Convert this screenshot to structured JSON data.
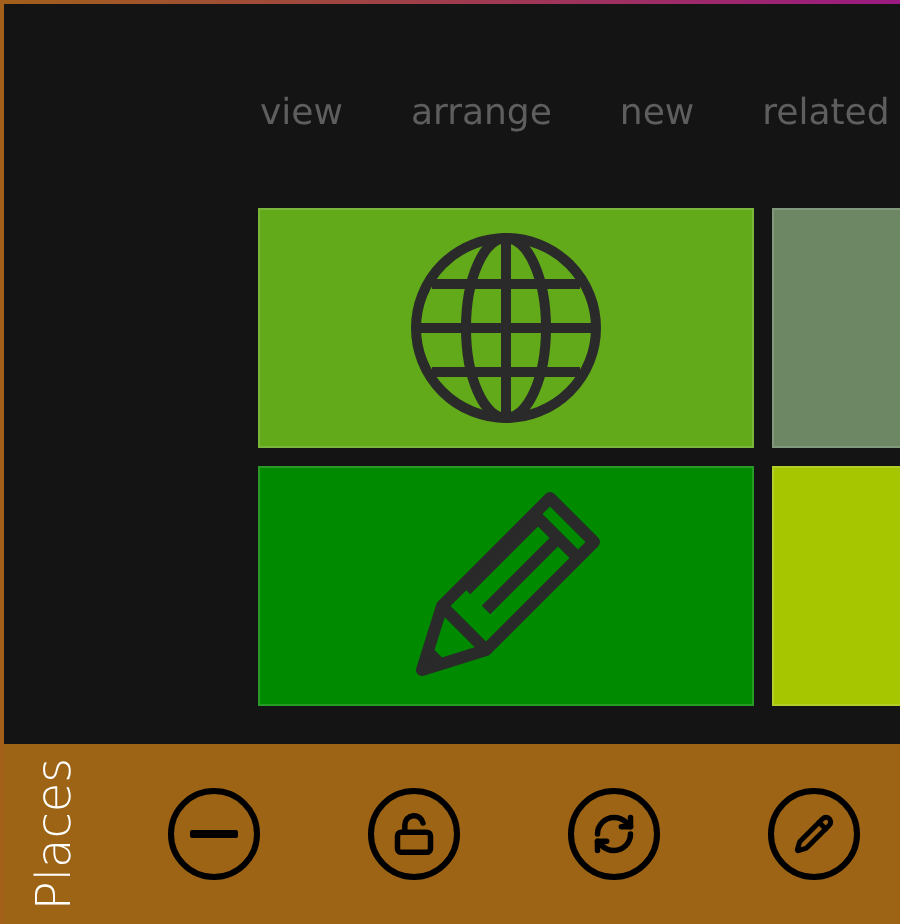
{
  "menu": [
    "view",
    "arrange",
    "new",
    "related"
  ],
  "tiles": [
    {
      "kind": "globe",
      "color": "#63aa1a"
    },
    {
      "kind": "plain",
      "color": "#6d8765"
    },
    {
      "kind": "pencil",
      "color": "#008a00"
    },
    {
      "kind": "plain",
      "color": "#a6c600"
    }
  ],
  "app_bar": {
    "title": "Places",
    "buttons": [
      {
        "kind": "remove"
      },
      {
        "kind": "unlock"
      },
      {
        "kind": "sync"
      },
      {
        "kind": "edit"
      }
    ]
  }
}
